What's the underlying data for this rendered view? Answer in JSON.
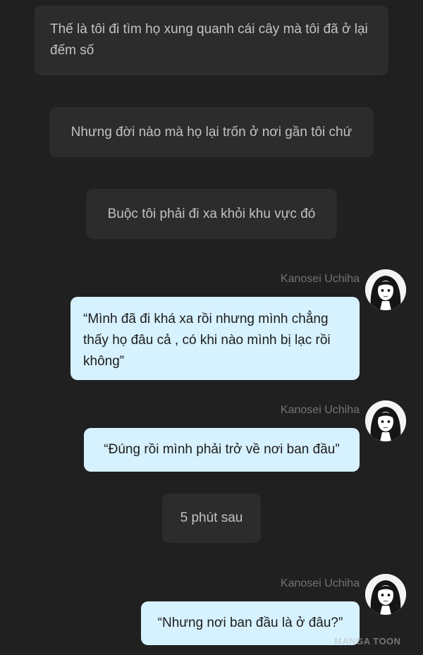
{
  "narration": [
    {
      "text": "Thế là tôi đi tìm họ xung quanh cái cây mà tôi đã ở lại đếm số"
    },
    {
      "text": "Nhưng đời nào mà họ lại trốn ở nơi gần tôi chứ"
    },
    {
      "text": "Buộc tôi phải đi xa khỏi khu vực đó"
    },
    {
      "text": "5 phút sau"
    }
  ],
  "messages": [
    {
      "speaker": "Kanosei Uchiha",
      "text": "“Mình đã đi khá xa rồi nhưng mình chẳng thấy họ đâu cả , có khi nào mình bị lạc rồi không”",
      "avatar": "girl-avatar"
    },
    {
      "speaker": "Kanosei Uchiha",
      "text": "“Đúng rồi mình phải trở về nơi ban đầu”",
      "avatar": "girl-avatar"
    },
    {
      "speaker": "Kanosei Uchiha",
      "text": "“Nhưng nơi ban đầu là ở đâu?”",
      "avatar": "girl-avatar"
    }
  ],
  "watermark": "MANGA TOON",
  "colors": {
    "background": "#202020",
    "narration_bubble": "#2c2c2c",
    "narration_text": "#c2c2c2",
    "message_bubble": "#d7f2ff",
    "message_text": "#1c1c1c",
    "speaker_name": "#747474"
  }
}
